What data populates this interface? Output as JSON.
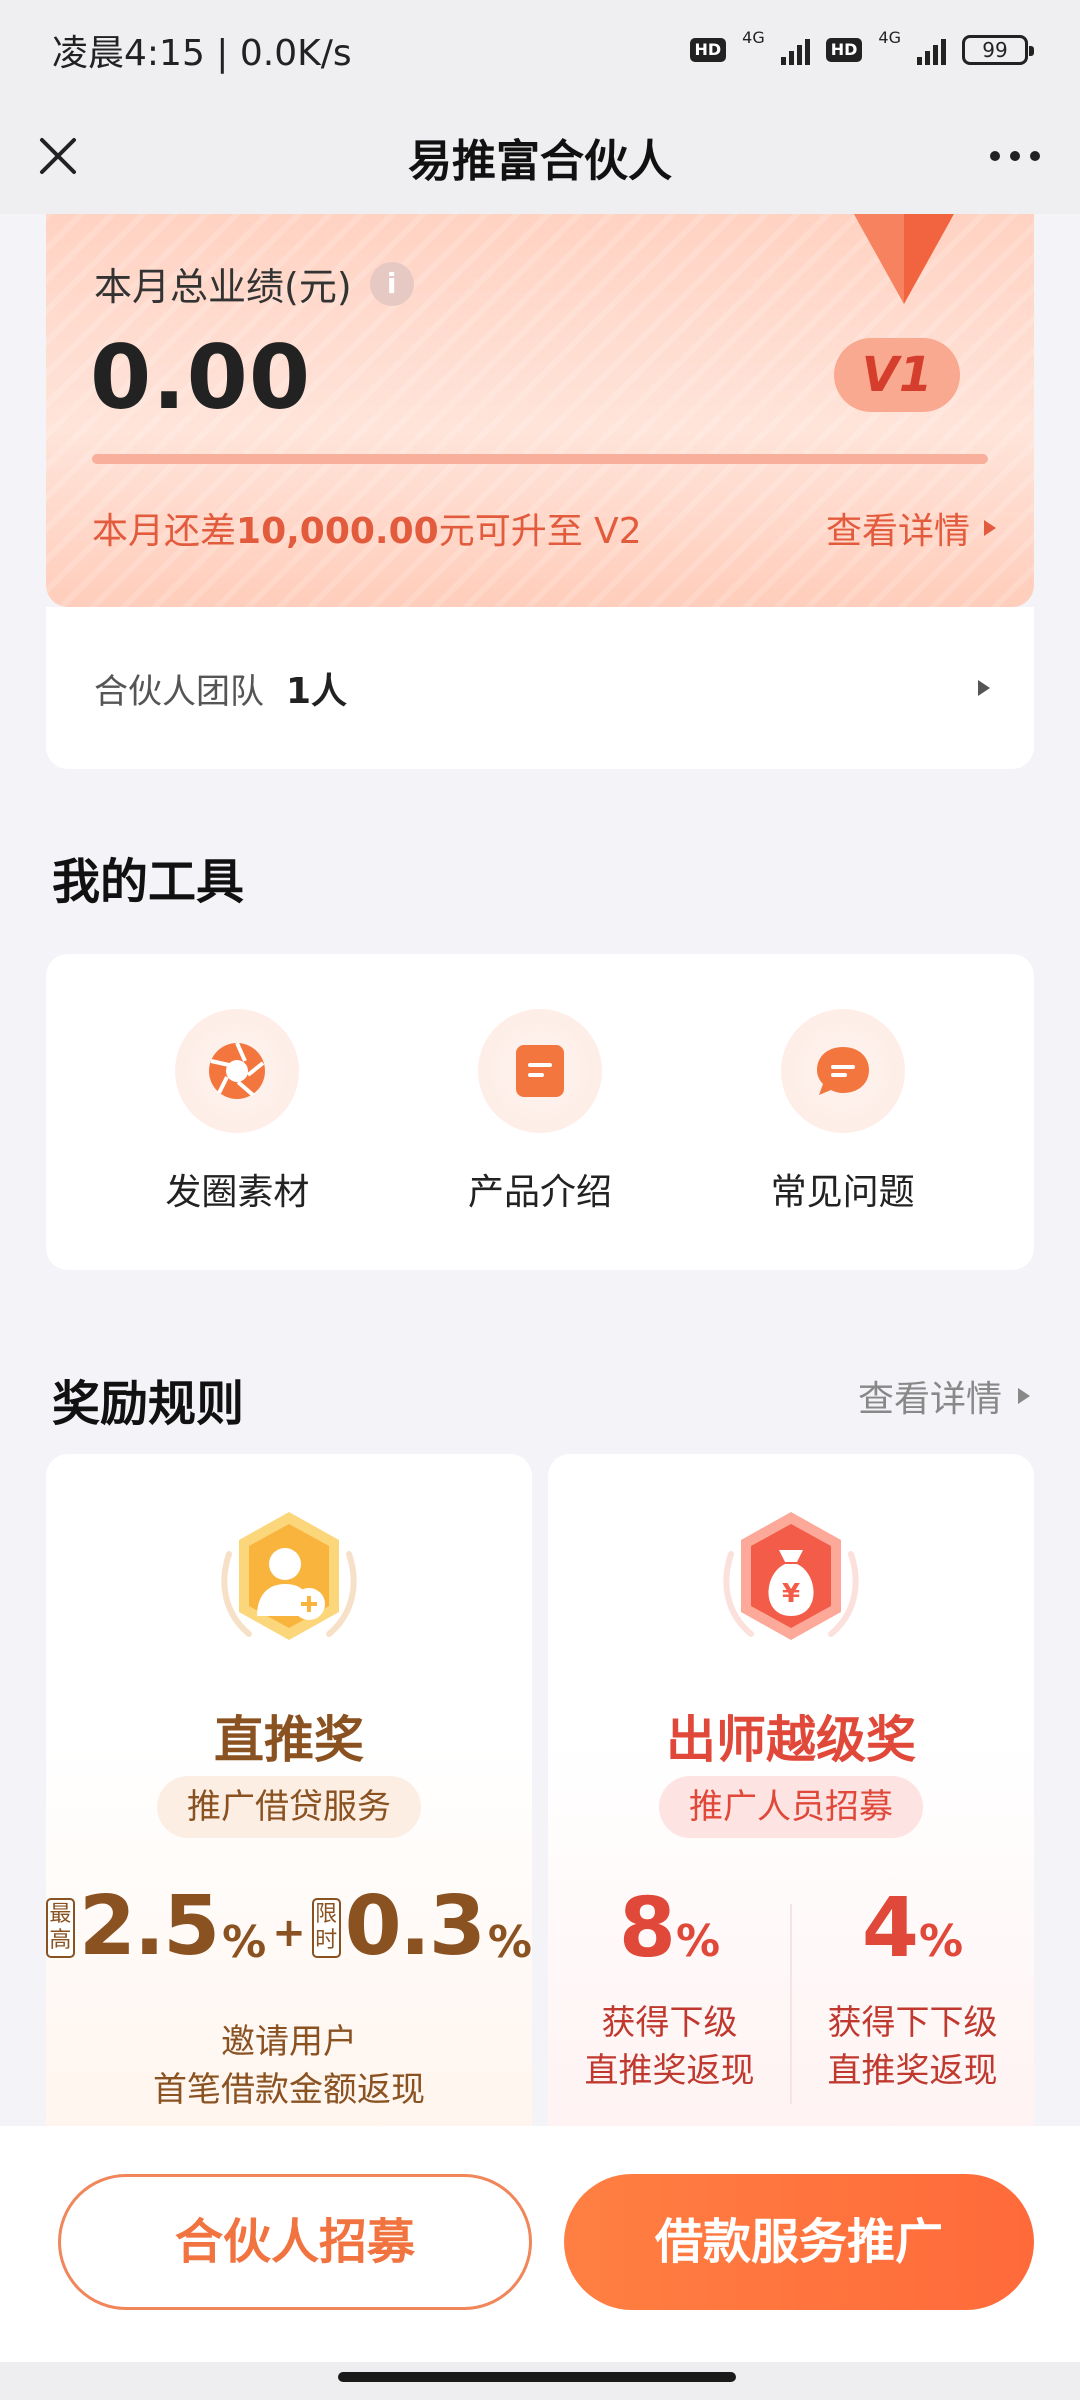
{
  "status_bar": {
    "time_speed": "凌晨4:15 | 0.0K/s",
    "hd1": "HD",
    "net1": "4G",
    "hd2": "HD",
    "net2": "4G",
    "battery": "99"
  },
  "navbar": {
    "title": "易推富合伙人",
    "close_icon": "close-icon",
    "more_icon": "more-dots-icon"
  },
  "performance": {
    "label": "本月总业绩(元)",
    "info_icon": "i",
    "amount": "0.00",
    "level": "V1",
    "progress": 0,
    "upgrade_prefix": "本月还差",
    "upgrade_amount": "10,000.00",
    "upgrade_suffix": "元可升至 V2",
    "detail_link": "查看详情",
    "colors": {
      "accent": "#e35b3d",
      "card_bg": "#ffd2c2"
    }
  },
  "team": {
    "label": "合伙人团队",
    "count": "1人"
  },
  "tools": {
    "title": "我的工具",
    "items": [
      {
        "label": "发圈素材",
        "icon": "aperture-icon"
      },
      {
        "label": "产品介绍",
        "icon": "document-icon"
      },
      {
        "label": "常见问题",
        "icon": "chat-bubble-icon"
      }
    ]
  },
  "rewards": {
    "title": "奖励规则",
    "detail_link": "查看详情",
    "direct": {
      "title": "直推奖",
      "tag": "推广借贷服务",
      "max_tag": "最高",
      "max_rate": "2.5",
      "pct": "%",
      "plus": "+",
      "limited_tag": "限时",
      "limited_rate": "0.3",
      "desc_line1": "邀请用户",
      "desc_line2": "首笔借款金额返现",
      "icon": "user-add-icon"
    },
    "mentor": {
      "title": "出师越级奖",
      "tag": "推广人员招募",
      "col1_rate": "8",
      "col1_desc1": "获得下级",
      "col1_desc2": "直推奖返现",
      "col2_rate": "4",
      "col2_desc1": "获得下下级",
      "col2_desc2": "直推奖返现",
      "pct": "%",
      "icon": "money-bag-icon"
    }
  },
  "bottom": {
    "recruit_button": "合伙人招募",
    "promote_button": "借款服务推广"
  }
}
